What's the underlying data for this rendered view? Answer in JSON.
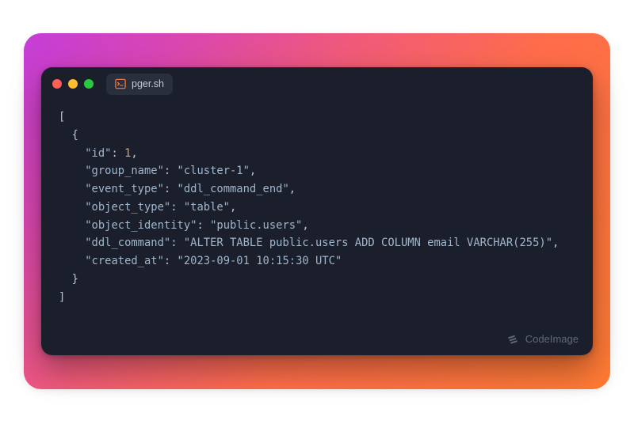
{
  "tab": {
    "filename": "pger.sh"
  },
  "watermark": {
    "label": "CodeImage"
  },
  "code": {
    "open_bracket": "[",
    "open_brace": "{",
    "close_brace": "}",
    "close_bracket": "]",
    "comma": ",",
    "colon_sep": ": ",
    "fields": {
      "id_key": "\"id\"",
      "id_val": "1",
      "group_name_key": "\"group_name\"",
      "group_name_val": "\"cluster-1\"",
      "event_type_key": "\"event_type\"",
      "event_type_val": "\"ddl_command_end\"",
      "object_type_key": "\"object_type\"",
      "object_type_val": "\"table\"",
      "object_identity_key": "\"object_identity\"",
      "object_identity_val": "\"public.users\"",
      "ddl_command_key": "\"ddl_command\"",
      "ddl_command_val": "\"ALTER TABLE public.users ADD COLUMN email VARCHAR(255)\"",
      "created_at_key": "\"created_at\"",
      "created_at_val": "\"2023-09-01 10:15:30 UTC\""
    }
  },
  "colors": {
    "window_bg": "#1b1f2b",
    "tab_bg": "#2a2f3d",
    "terminal_icon": "#f77b42"
  }
}
